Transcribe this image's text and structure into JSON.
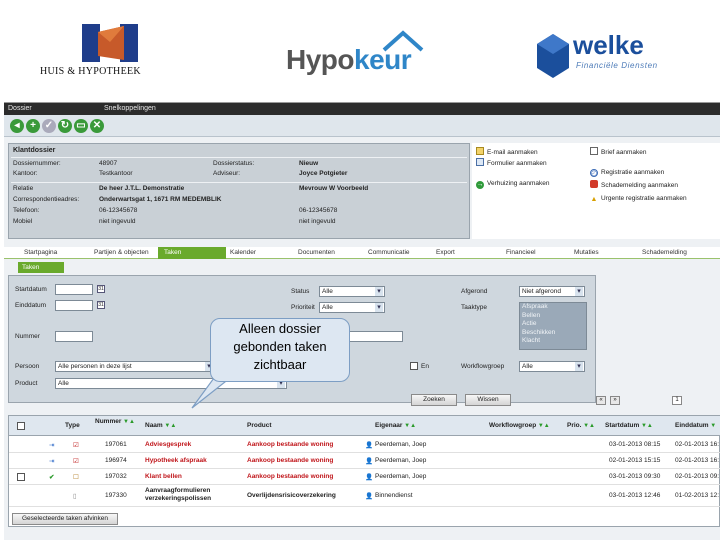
{
  "logos": {
    "huis_hypotheek": "HUIS & HYPOTHEEK",
    "hypokeur_a": "Hypo",
    "hypokeur_b": "keur",
    "welke": "welke",
    "welke_sub": "Financiële Diensten"
  },
  "menubar": {
    "dossier": "Dossier",
    "snelkoppelingen": "Snelkoppelingen"
  },
  "klantdossier": {
    "title": "Klantdossier",
    "dossiernummer_label": "Dossiernummer:",
    "dossiernummer": "48907",
    "dossierstatus_label": "Dossierstatus:",
    "dossierstatus": "Nieuw",
    "kantoor_label": "Kantoor:",
    "kantoor": "Testkantoor",
    "adviseur_label": "Adviseur:",
    "adviseur": "Joyce Potgieter",
    "relatie_label": "Relatie",
    "relatie": "De heer J.T.L. Demonstratie",
    "relatie2": "Mevrouw W Voorbeeld",
    "adres_label": "Correspondentieadres:",
    "adres": "Onderwartsgat 1, 1671 RM MEDEMBLIK",
    "telefoon_label": "Telefoon:",
    "telefoon": "06-12345678",
    "telefoon2": "06-12345678",
    "mobiel_label": "Mobiel",
    "mobiel": "niet ingevuld",
    "mobiel2": "niet ingevuld"
  },
  "actions": {
    "email": "E-mail aanmaken",
    "brief": "Brief aanmaken",
    "formulier": "Formulier aanmaken",
    "registratie": "Registratie aanmaken",
    "verhuizing": "Verhuizing aanmaken",
    "schade": "Schademelding aanmaken",
    "urgent": "Urgente registratie aanmaken"
  },
  "tabs": [
    "Startpagina",
    "Partijen & objecten",
    "Taken",
    "Kalender",
    "Documenten",
    "Communicatie",
    "Export",
    "Financieel",
    "Mutaties",
    "Schademelding"
  ],
  "active_tab": "Taken",
  "subtab": "Taken",
  "filter": {
    "startdatum_label": "Startdatum",
    "einddatum_label": "Einddatum",
    "nummer_label": "Nummer",
    "persoon_label": "Persoon",
    "persoon_value": "Alle personen in deze lijst",
    "product_label": "Product",
    "product_value": "Alle",
    "status_label": "Status",
    "status_value": "Alle",
    "prioriteit_label": "Prioriteit",
    "prioriteit_value": "Alle",
    "afgerond_label": "Afgerond",
    "afgerond_value": "Niet afgerond",
    "taaktype_label": "Taaktype",
    "taaktype_options": [
      "Afspraak",
      "Bellen",
      "Actie",
      "Beschikken",
      "Klacht"
    ],
    "workflowgroep_label": "Workflowgroep",
    "workflowgroep_value": "Alle",
    "en_label": "En",
    "zoeken": "Zoeken",
    "wissen": "Wissen",
    "page": "1"
  },
  "grid": {
    "headers": {
      "type": "Type",
      "nummer": "Nummer",
      "naam": "Naam",
      "product": "Product",
      "eigenaar": "Eigenaar",
      "workflowgroep": "Workflowgroep",
      "prio": "Prio.",
      "startdatum": "Startdatum",
      "einddatum": "Einddatum"
    },
    "rows": [
      {
        "nummer": "197061",
        "naam": "Adviesgesprek",
        "product": "Aankoop bestaande woning",
        "eigenaar": "Peerdeman, Joep",
        "start": "03-01-2013 08:15",
        "eind": "02-01-2013 16:"
      },
      {
        "nummer": "196974",
        "naam": "Hypotheek afspraak",
        "product": "Aankoop bestaande woning",
        "eigenaar": "Peerdeman, Joep",
        "start": "02-01-2013 15:15",
        "eind": "02-01-2013 16:"
      },
      {
        "nummer": "197032",
        "naam": "Klant bellen",
        "product": "Aankoop bestaande woning",
        "eigenaar": "Peerdeman, Joep",
        "start": "03-01-2013 09:30",
        "eind": "02-01-2013 09:"
      },
      {
        "nummer": "197330",
        "naam": "Aanvraagformulieren verzekeringspolissen",
        "product": "Overlijdensrisicoverzekering",
        "eigenaar": "Binnendienst",
        "start": "03-01-2013 12:46",
        "eind": "01-02-2013 12:"
      }
    ],
    "afvinken_button": "Geselecteerde taken afvinken"
  },
  "callout": {
    "line1": "Alleen dossier",
    "line2": "gebonden taken",
    "line3": "zichtbaar"
  }
}
